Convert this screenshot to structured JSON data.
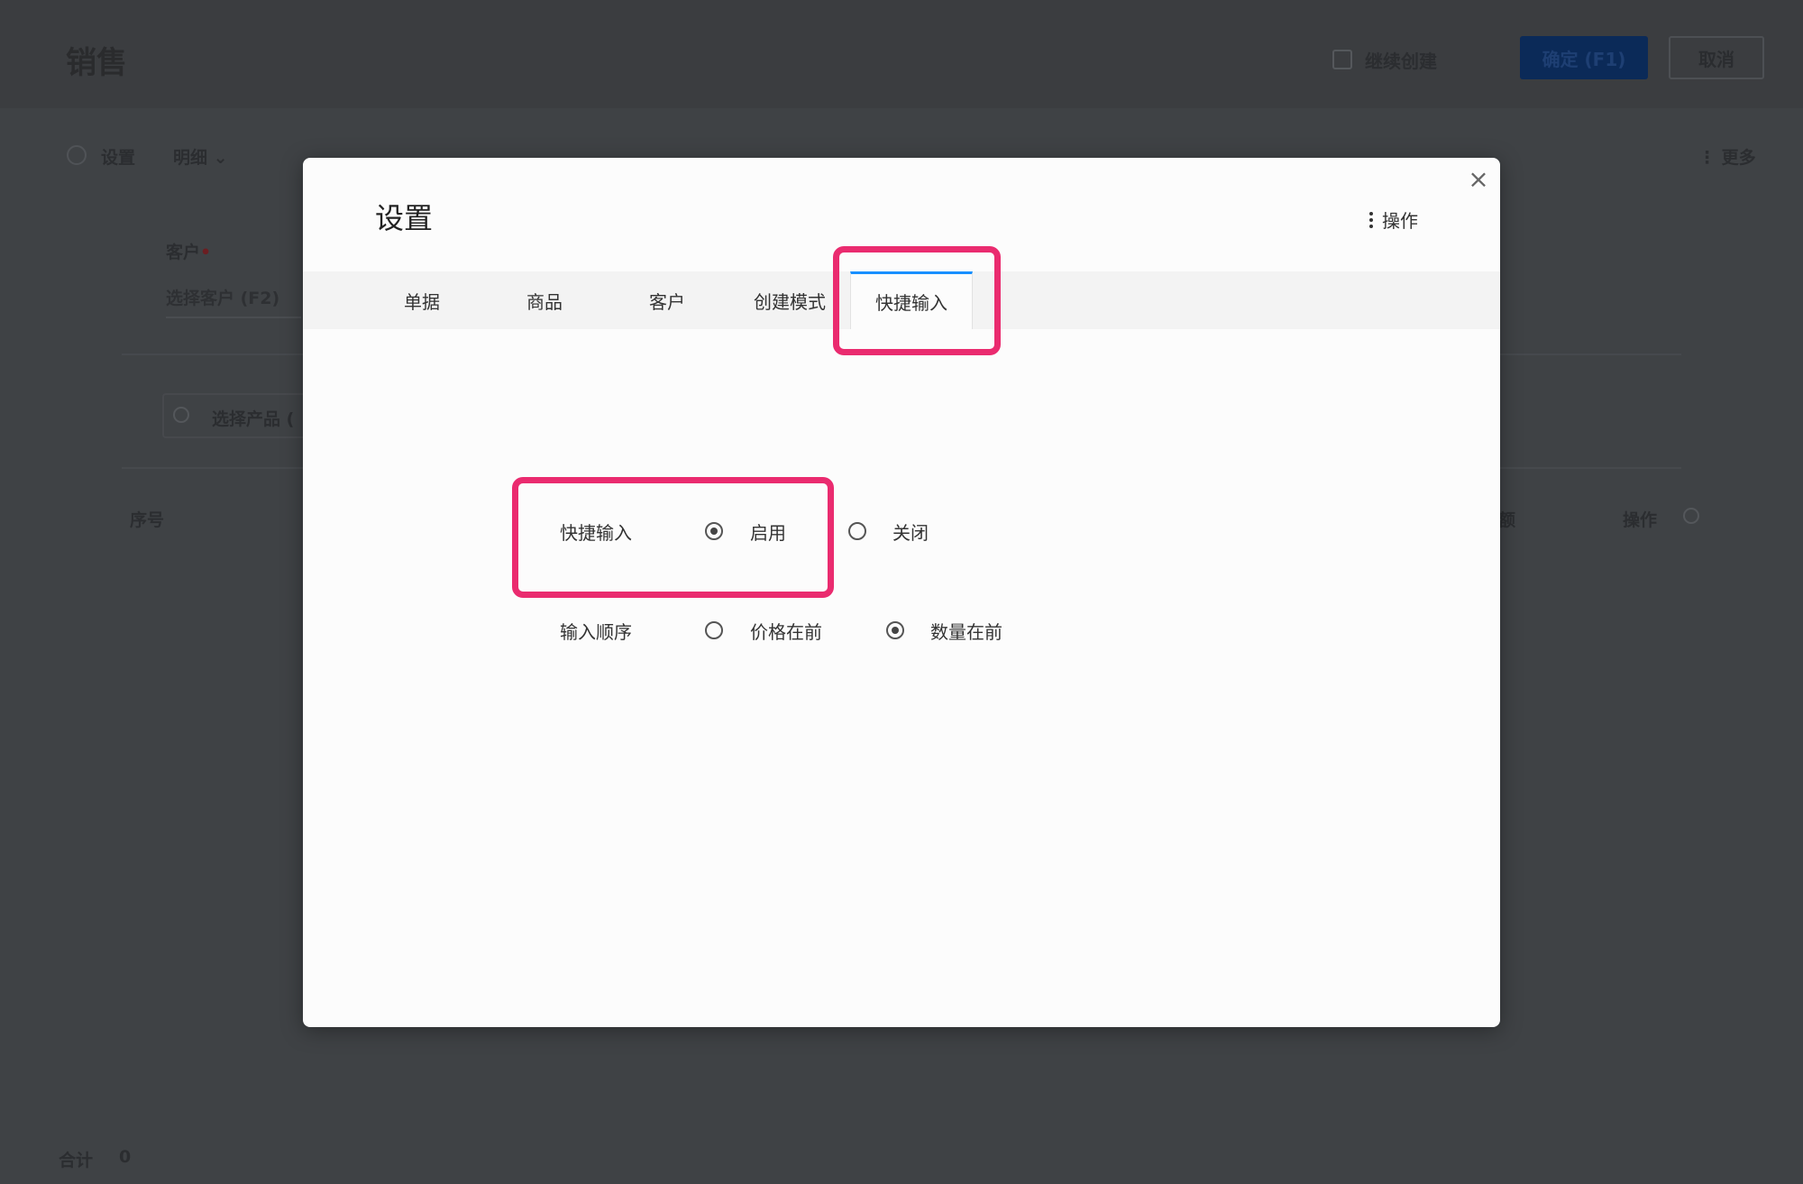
{
  "background": {
    "title": "销售",
    "continue_create_label": "继续创建",
    "confirm_button": "确定 (F1)",
    "cancel_button": "取消",
    "settings_label": "设置",
    "detail_label": "明细",
    "more_label": "更多",
    "customer_label": "客户",
    "customer_placeholder": "选择客户 (F2)",
    "product_search_placeholder": "选择产品 (",
    "columns": {
      "seq": "序号",
      "right_partial": "额",
      "operation": "操作"
    },
    "total_label": "合计",
    "total_value": "0"
  },
  "modal": {
    "title": "设置",
    "actions_label": "操作",
    "close_symbol": "×",
    "tabs": [
      {
        "label": "单据",
        "active": false
      },
      {
        "label": "商品",
        "active": false
      },
      {
        "label": "客户",
        "active": false
      },
      {
        "label": "创建模式",
        "active": false
      },
      {
        "label": "快捷输入",
        "active": true
      }
    ],
    "form": {
      "quick_input": {
        "label": "快捷输入",
        "options": [
          {
            "label": "启用",
            "checked": true
          },
          {
            "label": "关闭",
            "checked": false
          }
        ]
      },
      "input_order": {
        "label": "输入顺序",
        "options": [
          {
            "label": "价格在前",
            "checked": false
          },
          {
            "label": "数量在前",
            "checked": true
          }
        ]
      }
    }
  },
  "colors": {
    "highlight": "#ea2b6f",
    "tab_active_border": "#1890ff",
    "overlay": "#3f4245"
  }
}
